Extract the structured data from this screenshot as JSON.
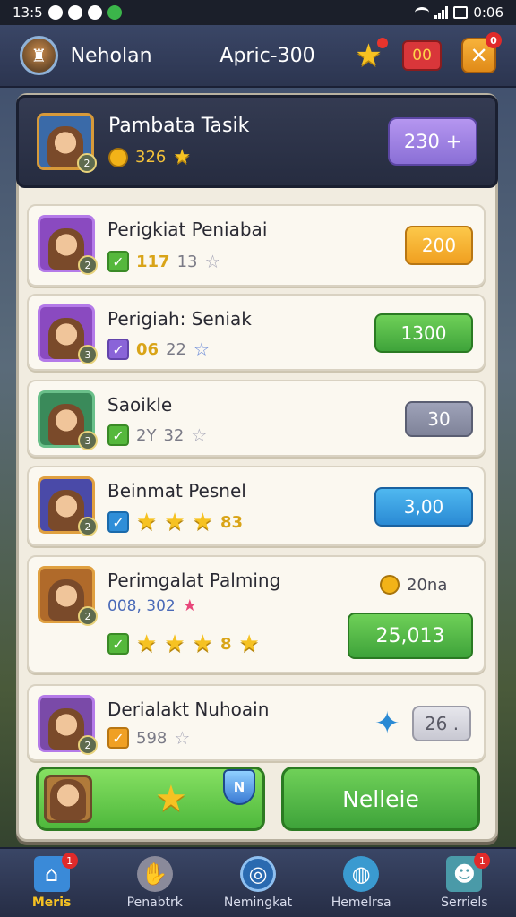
{
  "status_bar": {
    "time": "13:5",
    "clock": "0:06"
  },
  "header": {
    "name": "Neholan",
    "balance": "Apric-300",
    "pill": "00",
    "close": "✕",
    "close_badge": "0"
  },
  "hero": {
    "name": "Pambata Tasik",
    "score": "326",
    "button": "230 +",
    "level": "2"
  },
  "rows": [
    {
      "title": "Perigkiat Peniabai",
      "value1": "117",
      "value2": "13",
      "button": "200",
      "level": "2"
    },
    {
      "title": "Perigiah: Seniak",
      "value1": "06",
      "value2": "22",
      "button": "1300",
      "level": "3"
    },
    {
      "title": "Saoikle",
      "value1": "2Y",
      "value2": "32",
      "button": "30",
      "level": "3"
    },
    {
      "title": "Beinmat Pesnel",
      "value1": "83",
      "button": "3,00",
      "level": "2"
    },
    {
      "title": "Perimgalat Palming",
      "sub": "008, 302",
      "coin_value": "20na",
      "value1": "8",
      "button": "25,013",
      "level": "2"
    },
    {
      "title": "Derialakt Nuhoain",
      "value1": "598",
      "button": "26 .",
      "level": "2"
    }
  ],
  "actions": {
    "right": "Nelleie",
    "shield": "N"
  },
  "nav": [
    {
      "label": "Meris",
      "badge": "1",
      "icon": "home-icon",
      "active": true
    },
    {
      "label": "Penabtrk",
      "icon": "hand-icon",
      "active": false
    },
    {
      "label": "Nemingkat",
      "icon": "compass-icon",
      "active": false
    },
    {
      "label": "Hemelrsa",
      "icon": "globe-icon",
      "active": false
    },
    {
      "label": "Serriels",
      "badge": "1",
      "icon": "person-icon",
      "active": false
    }
  ]
}
